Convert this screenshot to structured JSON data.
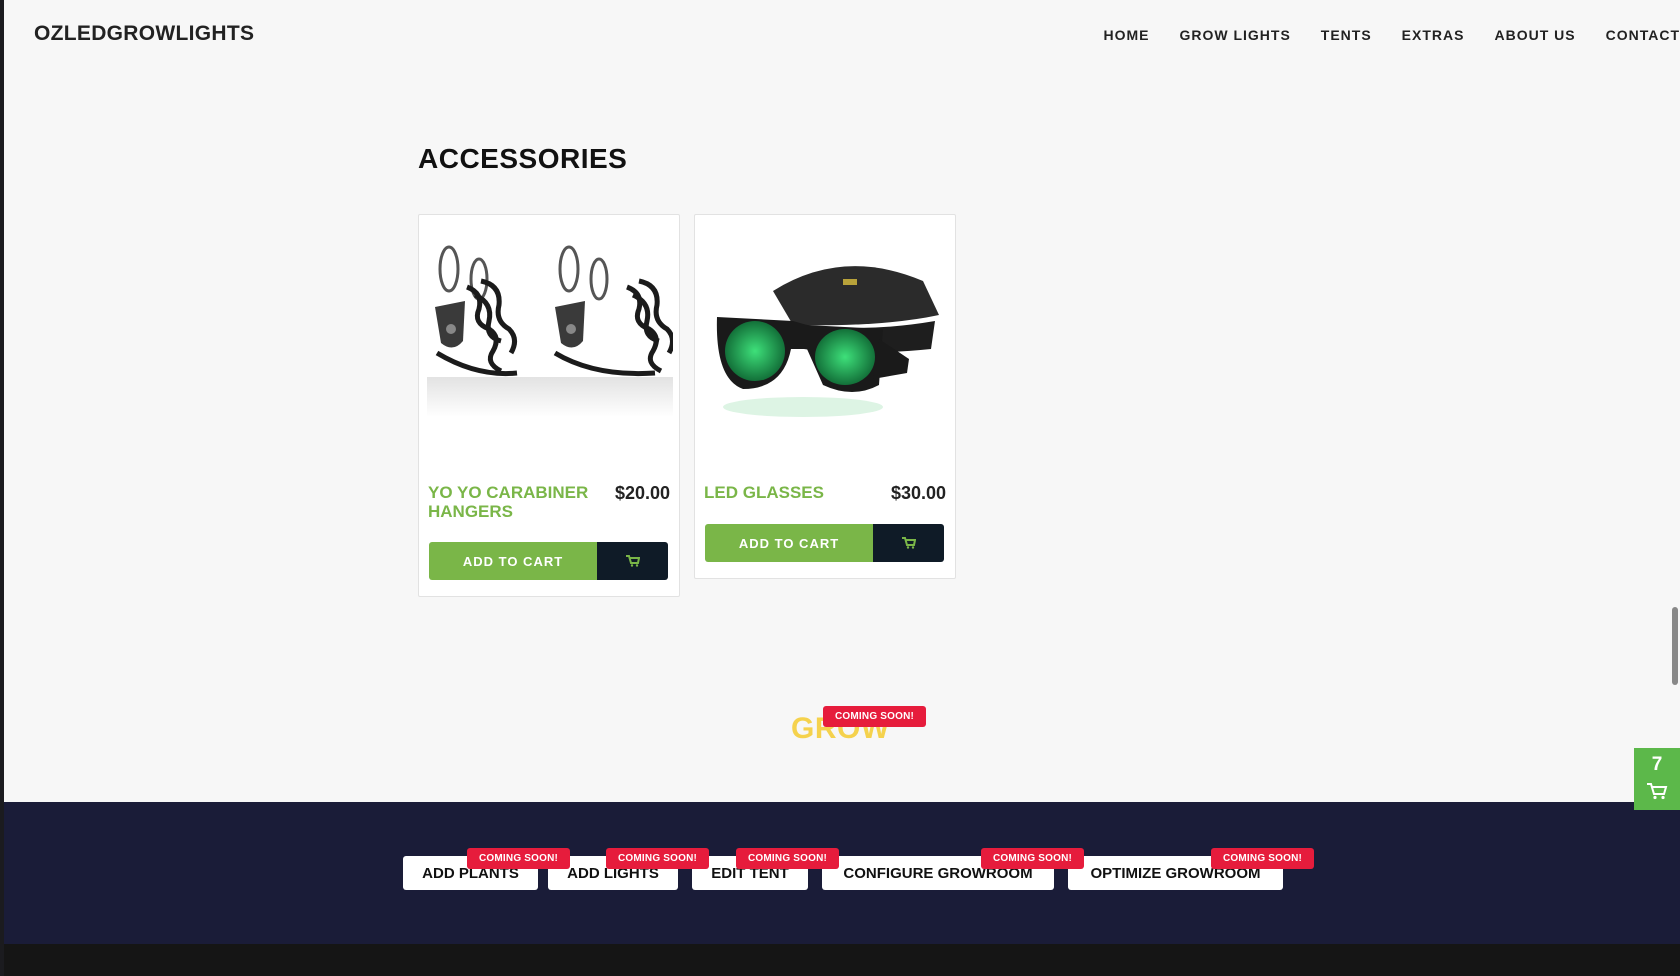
{
  "header": {
    "logo": "OZLEDGROWLIGHTS",
    "nav": [
      "HOME",
      "GROW LIGHTS",
      "TENTS",
      "EXTRAS",
      "ABOUT US",
      "CONTACT"
    ]
  },
  "section": {
    "title": "ACCESSORIES"
  },
  "products": [
    {
      "name": "YO YO CARABINER HANGERS",
      "price": "$20.00",
      "button": "ADD TO CART"
    },
    {
      "name": "LED GLASSES",
      "price": "$30.00",
      "button": "ADD TO CART"
    }
  ],
  "grow": {
    "title": "GROW",
    "badge": "COMING SOON!"
  },
  "footer_buttons": [
    {
      "label": "ADD PLANTS",
      "badge": "COMING SOON!"
    },
    {
      "label": "ADD LIGHTS",
      "badge": "COMING SOON!"
    },
    {
      "label": "EDIT TENT",
      "badge": "COMING SOON!"
    },
    {
      "label": "CONFIGURE GROWROOM",
      "badge": "COMING SOON!"
    },
    {
      "label": "OPTIMIZE GROWROOM",
      "badge": "COMING SOON!"
    }
  ],
  "cart_widget": {
    "count": "7"
  },
  "colors": {
    "accent_green": "#7ab648",
    "badge_red": "#e61c3c",
    "footer_navy": "#1a1c38",
    "grow_yellow": "#f5d24d"
  }
}
